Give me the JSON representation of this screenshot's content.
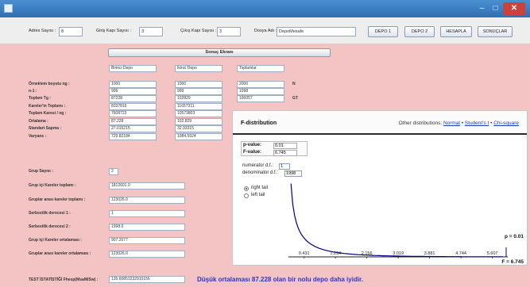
{
  "window": {
    "icon": "app-icon",
    "min": "‒",
    "max": "□",
    "close": "✕"
  },
  "toolbar": {
    "adres_label": "Adres Sayısı :",
    "adres_value": "8",
    "giris_label": "Giriş Kapı Sayısı :",
    "giris_value": "3",
    "cikis_label": "Çıkış Kapı Sayısı :",
    "cikis_value": "3",
    "dosya_label": "Dosya Adı :",
    "dosya_value": "DepoMesafe",
    "btn_depo1": "DEPO 1",
    "btn_depo2": "DEPO 2",
    "btn_hesapla": "HESAPLA",
    "btn_sonuclar": "SONUÇLAR"
  },
  "result_button": "Sonuç Ekranı",
  "table": {
    "headers": [
      "Birinci Depo",
      "İkinci Depo",
      "Toplamlar"
    ],
    "rows": [
      {
        "label": "Örneklem boyutu ng :",
        "values": [
          "1000",
          "1000",
          "2000"
        ],
        "unit": "N"
      },
      {
        "label": "n-1 :",
        "values": [
          "999",
          "999",
          "1998"
        ],
        "unit": ""
      },
      {
        "label": "Toplam Tg :",
        "values": [
          "87228",
          "102829",
          "190057"
        ],
        "unit": "GT"
      },
      {
        "label": "Kareler'in Toplamı :",
        "values": [
          "8337816",
          "11657311",
          ""
        ],
        "unit": ""
      },
      {
        "label": "Toplam Karesi / ng :",
        "values": [
          "7608723",
          "10573803",
          ""
        ],
        "unit": ""
      },
      {
        "label": "Ortalama :",
        "values": [
          "87.228",
          "102.829",
          ""
        ],
        "unit": ""
      },
      {
        "label": "Standart Sapma :",
        "values": [
          "27.015215",
          "32.93315",
          ""
        ],
        "unit": ""
      },
      {
        "label": "Varyans :",
        "values": [
          "729.82184",
          "1084.5924",
          ""
        ],
        "unit": ""
      }
    ]
  },
  "group": [
    {
      "label": "Grup Sayısı :",
      "value": "2"
    },
    {
      "label": "Grup içi Kareler toplamı :",
      "value": "1812601.0"
    },
    {
      "label": "Gruplar arası kareler toplamı :",
      "value": "123026.0"
    },
    {
      "label": "Serbestlik derecesi 1 :",
      "value": "1"
    },
    {
      "label": "Serbestlik derecesi 2 :",
      "value": "1998.0"
    },
    {
      "label": "Grup içi Kareler ortalaması :",
      "value": "907.2077"
    },
    {
      "label": "Gruplar arası kareler ortalaması :",
      "value": "123026.0"
    }
  ],
  "test": {
    "label": "TEST İSTATİSTİĞİ Fhesp(MsaM/Sw) :",
    "value": "135.60851232910156",
    "result": "Düşük ortalaması 87.228  olan bir nolu depo daha iyidir."
  },
  "fpanel": {
    "title": "F-distribution",
    "other_label": "Other distributions:",
    "links": [
      "Normal",
      "Student's t",
      "Chi-square"
    ],
    "pvalue_label": "p-value:",
    "pvalue": "0.01",
    "fvalue_label": "F-value:",
    "fvalue": "6.745",
    "num_df_label": "numerator d.f.:",
    "num_df": "1",
    "den_df_label": "denominator d.f.:",
    "den_df": "1998",
    "right_tail": "right tail",
    "left_tail": "left tail",
    "tail_selected": "right"
  },
  "chart_data": {
    "type": "line",
    "x_ticks": [
      "0.431",
      "1.294",
      "2.156",
      "3.019",
      "3.881",
      "4.744",
      "5.607"
    ],
    "annotations": [
      "p = 0.01",
      "F = 6.745"
    ],
    "curve_color": "#00008b"
  }
}
